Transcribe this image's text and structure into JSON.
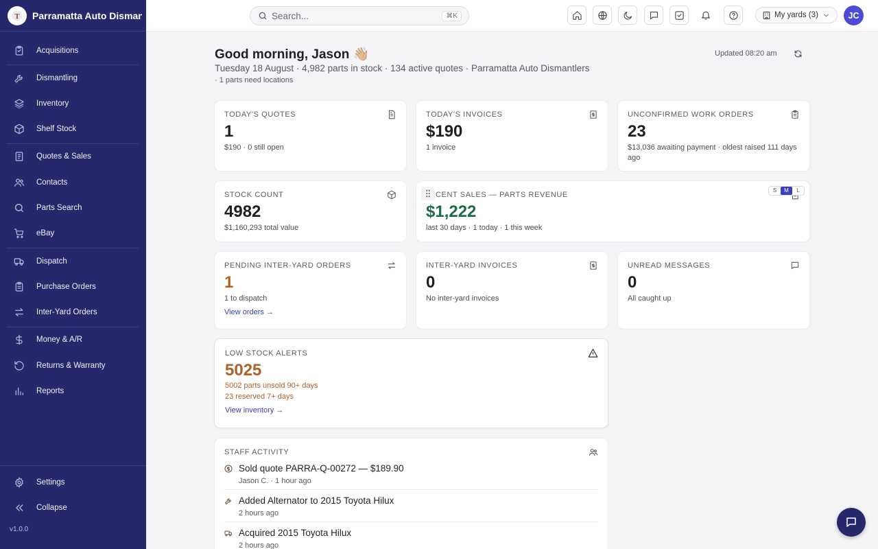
{
  "app": {
    "name": "Parramatta Auto Dismantlers",
    "version": "v1.0.0"
  },
  "sidebar": {
    "items": [
      {
        "label": "Acquisitions",
        "icon": "clipboard-icon"
      },
      {
        "label": "Dismantling",
        "icon": "wrench-icon"
      },
      {
        "label": "Inventory",
        "icon": "layers-icon"
      },
      {
        "label": "Shelf Stock",
        "icon": "box-icon"
      },
      {
        "label": "Quotes & Sales",
        "icon": "receipt-icon"
      },
      {
        "label": "Contacts",
        "icon": "users-icon"
      },
      {
        "label": "Parts Search",
        "icon": "search-icon"
      },
      {
        "label": "eBay",
        "icon": "cart-icon"
      },
      {
        "label": "Dispatch",
        "icon": "truck-icon"
      },
      {
        "label": "Purchase Orders",
        "icon": "clipboard-list-icon"
      },
      {
        "label": "Inter-Yard Orders",
        "icon": "swap-icon"
      },
      {
        "label": "Money & A/R",
        "icon": "dollar-icon"
      },
      {
        "label": "Returns & Warranty",
        "icon": "rotate-icon"
      },
      {
        "label": "Reports",
        "icon": "bar-chart-icon"
      }
    ],
    "settings": "Settings",
    "collapse": "Collapse"
  },
  "topbar": {
    "search_placeholder": "Search...",
    "shortcut": "⌘K",
    "yards_label": "My yards (3)",
    "avatar_initials": "JC"
  },
  "header": {
    "greeting": "Good morning, Jason 👋🏼",
    "subline": "Tuesday 18 August · 4,982 parts in stock · 134 active quotes · Parramatta Auto Dismantlers",
    "subline2": "· 1 parts need locations",
    "updated": "Updated 08:20 am"
  },
  "cards": {
    "quotes": {
      "label": "TODAY'S QUOTES",
      "value": "1",
      "sub": "$190 · 0 still open"
    },
    "invoices": {
      "label": "TODAY'S INVOICES",
      "value": "$190",
      "sub": "1 invoice"
    },
    "work_orders": {
      "label": "UNCONFIRMED WORK ORDERS",
      "value": "23",
      "sub": "$13,036 awaiting payment · oldest raised 111 days ago"
    },
    "stock": {
      "label": "STOCK COUNT",
      "value": "4982",
      "sub": "$1,160,293 total value"
    },
    "sales": {
      "label": "CENT SALES — PARTS REVENUE",
      "value": "$1,222",
      "sub": "last 30 days · 1 today · 1 this week",
      "sizes": [
        "S",
        "M",
        "L"
      ]
    },
    "pending_iy": {
      "label": "PENDING INTER-YARD ORDERS",
      "value": "1",
      "sub": "1 to dispatch",
      "link": "View orders →"
    },
    "iy_invoices": {
      "label": "INTER-YARD INVOICES",
      "value": "0",
      "sub": "No inter-yard invoices"
    },
    "messages": {
      "label": "UNREAD MESSAGES",
      "value": "0",
      "sub": "All caught up"
    },
    "low_stock": {
      "label": "LOW STOCK ALERTS",
      "value": "5025",
      "sub1": "5002 parts unsold 90+ days",
      "sub2": "23 reserved 7+ days",
      "link": "View inventory →"
    }
  },
  "activity": {
    "label": "STAFF ACTIVITY",
    "items": [
      {
        "title": "Sold quote PARRA-Q-00272 — $189.90",
        "meta": "Jason C. · 1 hour ago",
        "icon": "dollar-circle-icon"
      },
      {
        "title": "Added Alternator to 2015 Toyota Hilux",
        "meta": "2 hours ago",
        "icon": "wrench-icon"
      },
      {
        "title": "Acquired 2015 Toyota Hilux",
        "meta": "2 hours ago",
        "icon": "truck-icon"
      }
    ]
  },
  "colors": {
    "sidebar": "#27286c",
    "accent": "#3d3fb8",
    "positive": "#1f6b44",
    "warning": "#b0612a"
  }
}
